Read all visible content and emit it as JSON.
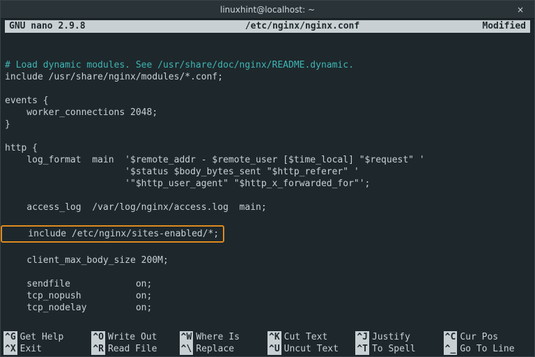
{
  "titlebar": {
    "title": "linuxhint@localhost: ~",
    "close_glyph": "×"
  },
  "nano": {
    "version": "GNU nano 2.9.8",
    "filename": "/etc/nginx/nginx.conf",
    "status": "Modified"
  },
  "content": {
    "comment": "# Load dynamic modules. See /usr/share/doc/nginx/README.dynamic.",
    "l1": "include /usr/share/nginx/modules/*.conf;",
    "l2": "",
    "l3": "events {",
    "l4": "    worker_connections 2048;",
    "l5": "}",
    "l6": "",
    "l7": "http {",
    "l8": "    log_format  main  '$remote_addr - $remote_user [$time_local] \"$request\" '",
    "l9": "                      '$status $body_bytes_sent \"$http_referer\" '",
    "l10": "                      '\"$http_user_agent\" \"$http_x_forwarded_for\"';",
    "l11": "",
    "l12": "    access_log  /var/log/nginx/access.log  main;",
    "l13": "",
    "l14_hl": "    include /etc/nginx/sites-enabled/*;",
    "l15": "",
    "l16": "    client_max_body_size 200M;",
    "l17": "",
    "l18": "    sendfile            on;",
    "l19": "    tcp_nopush          on;",
    "l20": "    tcp_nodelay         on;"
  },
  "shortcuts": {
    "r1": [
      {
        "key": "^G",
        "label": "Get Help"
      },
      {
        "key": "^O",
        "label": "Write Out"
      },
      {
        "key": "^W",
        "label": "Where Is"
      },
      {
        "key": "^K",
        "label": "Cut Text"
      },
      {
        "key": "^J",
        "label": "Justify"
      },
      {
        "key": "^C",
        "label": "Cur Pos"
      }
    ],
    "r2": [
      {
        "key": "^X",
        "label": "Exit"
      },
      {
        "key": "^R",
        "label": "Read File"
      },
      {
        "key": "^\\",
        "label": "Replace"
      },
      {
        "key": "^U",
        "label": "Uncut Text"
      },
      {
        "key": "^T",
        "label": "To Spell"
      },
      {
        "key": "^_",
        "label": "Go To Line"
      }
    ]
  }
}
